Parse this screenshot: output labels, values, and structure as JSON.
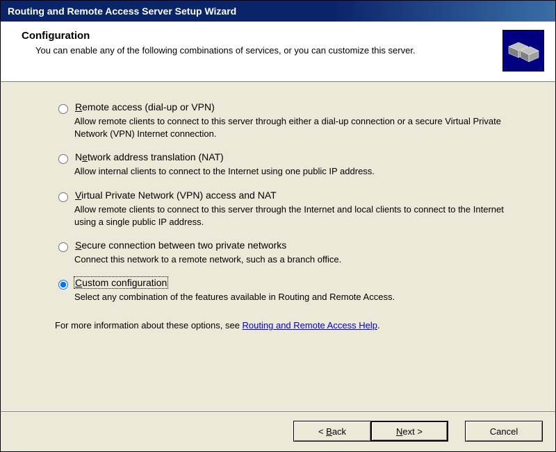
{
  "window": {
    "title": "Routing and Remote Access Server Setup Wizard"
  },
  "header": {
    "title": "Configuration",
    "subtitle": "You can enable any of the following combinations of services, or you can customize this server."
  },
  "options": [
    {
      "hotkey": "R",
      "label_pre": "",
      "label_rest": "emote access (dial-up or VPN)",
      "desc": "Allow remote clients to connect to this server through either a dial-up connection or a secure Virtual Private Network (VPN) Internet connection.",
      "selected": false
    },
    {
      "hotkey": "e",
      "label_pre": "N",
      "label_rest": "twork address translation (NAT)",
      "desc": "Allow internal clients to connect to the Internet using one public IP address.",
      "selected": false
    },
    {
      "hotkey": "V",
      "label_pre": "",
      "label_rest": "irtual Private Network (VPN) access and NAT",
      "desc": "Allow remote clients to connect to this server through the Internet and local clients to connect to the Internet using a single public IP address.",
      "selected": false
    },
    {
      "hotkey": "S",
      "label_pre": "",
      "label_rest": "ecure connection between two private networks",
      "desc": "Connect this network to a remote network, such as a branch office.",
      "selected": false
    },
    {
      "hotkey": "C",
      "label_pre": "",
      "label_rest": "ustom configuration",
      "desc": "Select any combination of the features available in Routing and Remote Access.",
      "selected": true
    }
  ],
  "info": {
    "prefix": "For more information about these options, see ",
    "link": "Routing and Remote Access Help",
    "suffix": "."
  },
  "buttons": {
    "back": {
      "lt": "< ",
      "hot": "B",
      "rest": "ack"
    },
    "next": {
      "hot": "N",
      "rest": "ext >"
    },
    "cancel": "Cancel"
  }
}
